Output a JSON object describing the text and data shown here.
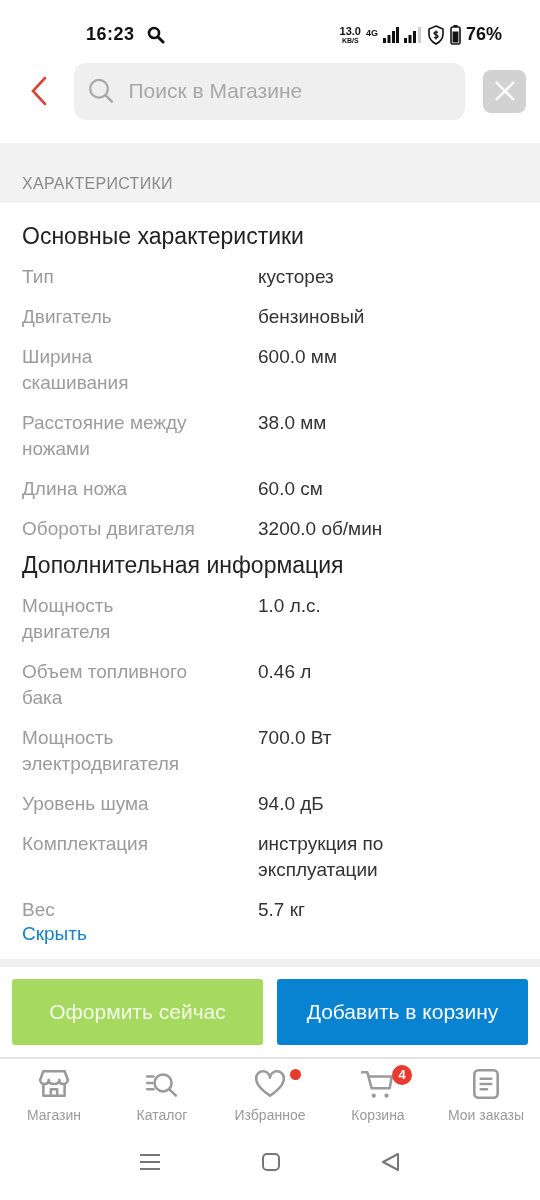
{
  "status_bar": {
    "time": "16:23",
    "net_speed": "13.0",
    "net_unit": "KB/S",
    "network": "4G",
    "battery": "76%"
  },
  "search": {
    "placeholder": "Поиск в Магазине"
  },
  "section_title": "ХАРАКТЕРИСТИКИ",
  "groups": [
    {
      "title": "Основные характеристики",
      "rows": [
        {
          "label": "Тип",
          "value": "кусторез"
        },
        {
          "label": "Двигатель",
          "value": "бензиновый"
        },
        {
          "label": "Ширина скашивания",
          "value": "600.0 мм"
        },
        {
          "label": "Расстояние между ножами",
          "value": "38.0 мм"
        },
        {
          "label": "Длина ножа",
          "value": "60.0 см"
        },
        {
          "label": "Обороты двигателя",
          "value": "3200.0 об/мин"
        }
      ]
    },
    {
      "title": "Дополнительная информация",
      "rows": [
        {
          "label": "Мощность двигателя",
          "value": "1.0 л.с."
        },
        {
          "label": "Объем топливного бака",
          "value": "0.46 л"
        },
        {
          "label": "Мощность электродвигателя",
          "value": "700.0 Вт"
        },
        {
          "label": "Уровень шума",
          "value": "94.0 дБ"
        },
        {
          "label": "Комплектация",
          "value": "инструкция по эксплуатации"
        },
        {
          "label": "Вес",
          "value": "5.7 кг"
        }
      ]
    }
  ],
  "collapse_link": "Скрыть",
  "actions": [
    {
      "kind": "checkout",
      "label": "Оформить сейчас"
    },
    {
      "kind": "cart",
      "label": "Добавить в корзину"
    }
  ],
  "nav": [
    {
      "kind": "store",
      "label": "Магазин",
      "dot": false
    },
    {
      "kind": "catalog",
      "label": "Каталог",
      "dot": false
    },
    {
      "kind": "favorites",
      "label": "Избранное",
      "dot": true
    },
    {
      "kind": "cart",
      "label": "Корзина",
      "dot": false,
      "badge": "4"
    },
    {
      "kind": "orders",
      "label": "Мои заказы",
      "dot": false
    }
  ]
}
